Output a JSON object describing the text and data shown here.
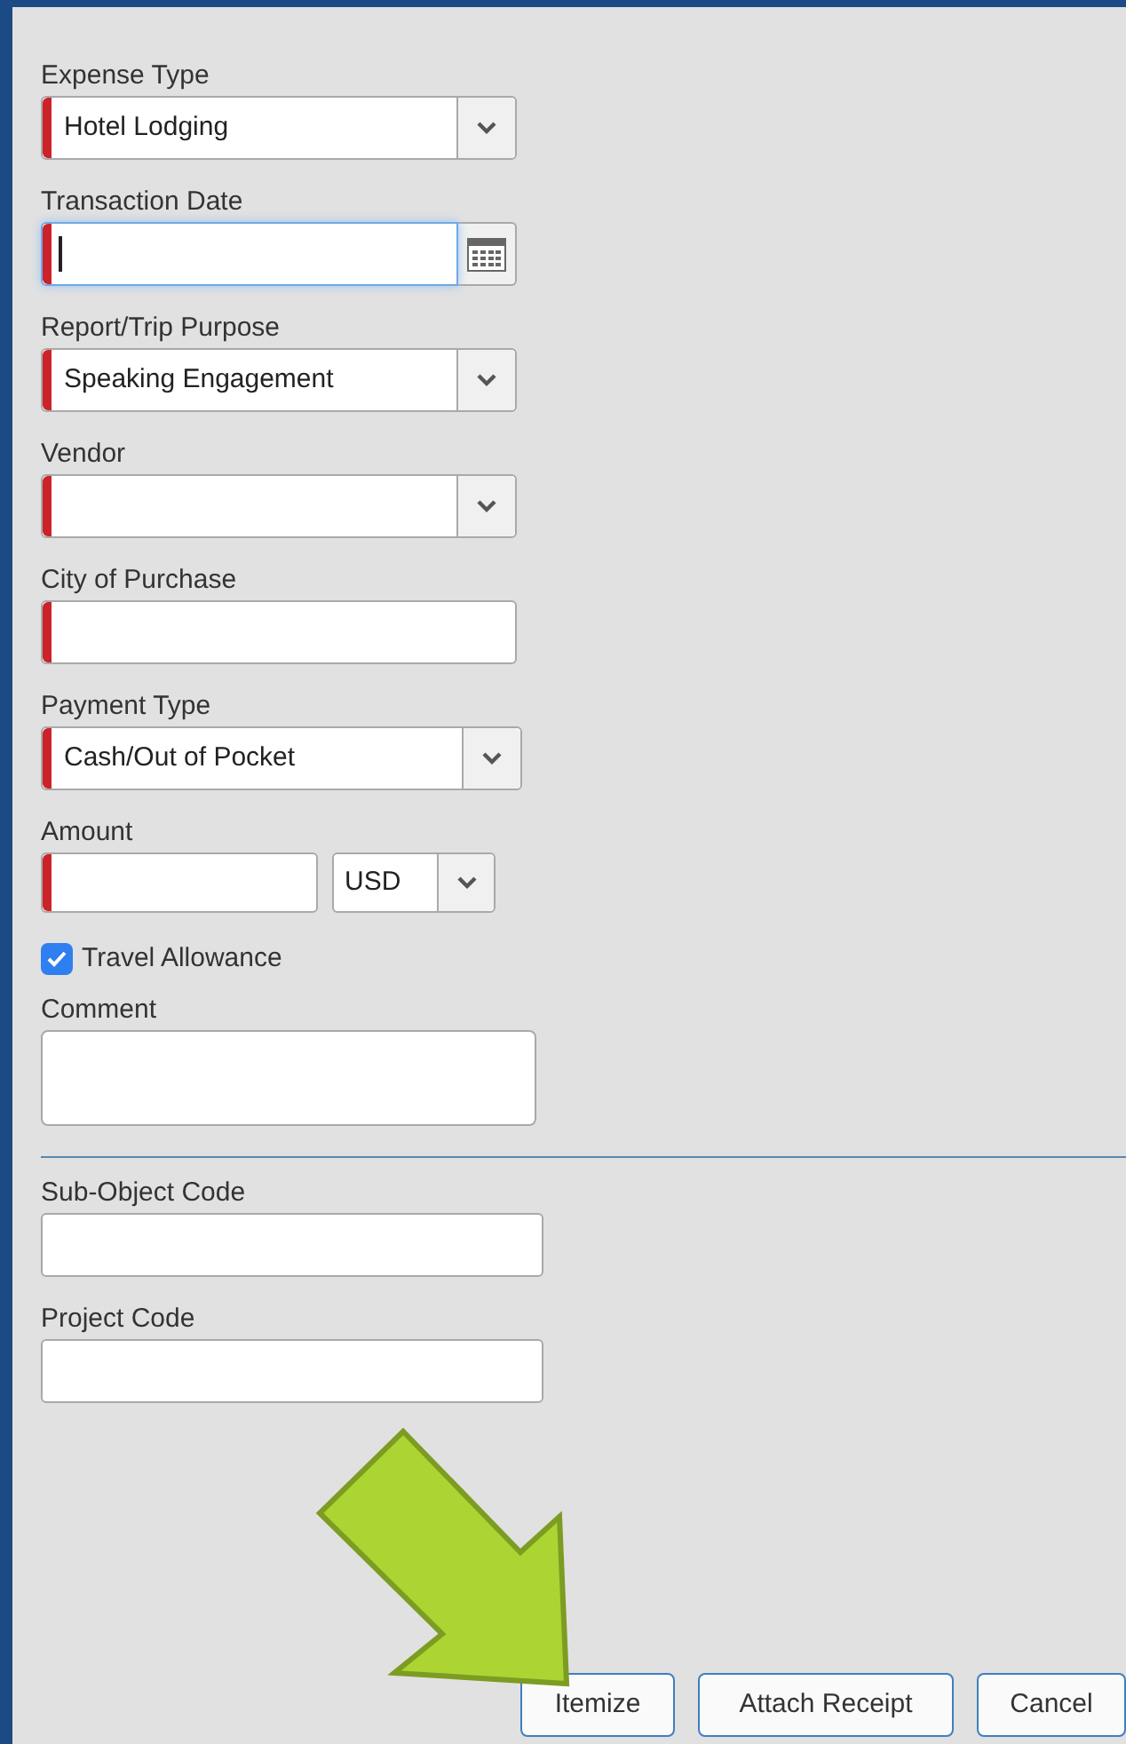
{
  "fields": [
    {
      "kind": "select",
      "label": "Expense Type",
      "value": "Hotel Lodging",
      "required": true
    },
    {
      "kind": "date",
      "label": "Transaction Date",
      "required": true,
      "focused": true
    },
    {
      "kind": "select",
      "label": "Report/Trip Purpose",
      "value": "Speaking Engagement",
      "required": true
    },
    {
      "kind": "select",
      "label": "Vendor",
      "required": true
    },
    {
      "kind": "text",
      "label": "City of Purchase",
      "required": true
    },
    {
      "kind": "select",
      "label": "Payment Type",
      "value": "Cash/Out of Pocket",
      "required": true
    },
    {
      "kind": "amount",
      "label": "Amount",
      "required": true,
      "currency": "USD"
    },
    {
      "kind": "checkbox",
      "label": "Travel Allowance",
      "checked": true
    },
    {
      "kind": "textarea",
      "label": "Comment",
      "required": false
    },
    {
      "kind": "divider"
    },
    {
      "kind": "text",
      "label": "Sub-Object Code",
      "required": false
    },
    {
      "kind": "text",
      "label": "Project Code",
      "required": false
    }
  ],
  "buttons": [
    "Itemize",
    "Attach Receipt",
    "Cancel"
  ]
}
